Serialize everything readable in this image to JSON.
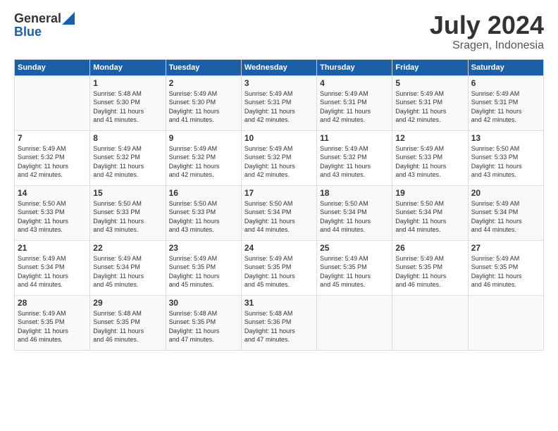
{
  "header": {
    "logo_general": "General",
    "logo_blue": "Blue",
    "month_title": "July 2024",
    "location": "Sragen, Indonesia"
  },
  "days_of_week": [
    "Sunday",
    "Monday",
    "Tuesday",
    "Wednesday",
    "Thursday",
    "Friday",
    "Saturday"
  ],
  "weeks": [
    {
      "days": [
        {
          "number": "",
          "sunrise": "",
          "sunset": "",
          "daylight": ""
        },
        {
          "number": "1",
          "sunrise": "Sunrise: 5:48 AM",
          "sunset": "Sunset: 5:30 PM",
          "daylight": "Daylight: 11 hours and 41 minutes."
        },
        {
          "number": "2",
          "sunrise": "Sunrise: 5:49 AM",
          "sunset": "Sunset: 5:30 PM",
          "daylight": "Daylight: 11 hours and 41 minutes."
        },
        {
          "number": "3",
          "sunrise": "Sunrise: 5:49 AM",
          "sunset": "Sunset: 5:31 PM",
          "daylight": "Daylight: 11 hours and 42 minutes."
        },
        {
          "number": "4",
          "sunrise": "Sunrise: 5:49 AM",
          "sunset": "Sunset: 5:31 PM",
          "daylight": "Daylight: 11 hours and 42 minutes."
        },
        {
          "number": "5",
          "sunrise": "Sunrise: 5:49 AM",
          "sunset": "Sunset: 5:31 PM",
          "daylight": "Daylight: 11 hours and 42 minutes."
        },
        {
          "number": "6",
          "sunrise": "Sunrise: 5:49 AM",
          "sunset": "Sunset: 5:31 PM",
          "daylight": "Daylight: 11 hours and 42 minutes."
        }
      ]
    },
    {
      "days": [
        {
          "number": "7",
          "sunrise": "Sunrise: 5:49 AM",
          "sunset": "Sunset: 5:32 PM",
          "daylight": "Daylight: 11 hours and 42 minutes."
        },
        {
          "number": "8",
          "sunrise": "Sunrise: 5:49 AM",
          "sunset": "Sunset: 5:32 PM",
          "daylight": "Daylight: 11 hours and 42 minutes."
        },
        {
          "number": "9",
          "sunrise": "Sunrise: 5:49 AM",
          "sunset": "Sunset: 5:32 PM",
          "daylight": "Daylight: 11 hours and 42 minutes."
        },
        {
          "number": "10",
          "sunrise": "Sunrise: 5:49 AM",
          "sunset": "Sunset: 5:32 PM",
          "daylight": "Daylight: 11 hours and 42 minutes."
        },
        {
          "number": "11",
          "sunrise": "Sunrise: 5:49 AM",
          "sunset": "Sunset: 5:32 PM",
          "daylight": "Daylight: 11 hours and 43 minutes."
        },
        {
          "number": "12",
          "sunrise": "Sunrise: 5:49 AM",
          "sunset": "Sunset: 5:33 PM",
          "daylight": "Daylight: 11 hours and 43 minutes."
        },
        {
          "number": "13",
          "sunrise": "Sunrise: 5:50 AM",
          "sunset": "Sunset: 5:33 PM",
          "daylight": "Daylight: 11 hours and 43 minutes."
        }
      ]
    },
    {
      "days": [
        {
          "number": "14",
          "sunrise": "Sunrise: 5:50 AM",
          "sunset": "Sunset: 5:33 PM",
          "daylight": "Daylight: 11 hours and 43 minutes."
        },
        {
          "number": "15",
          "sunrise": "Sunrise: 5:50 AM",
          "sunset": "Sunset: 5:33 PM",
          "daylight": "Daylight: 11 hours and 43 minutes."
        },
        {
          "number": "16",
          "sunrise": "Sunrise: 5:50 AM",
          "sunset": "Sunset: 5:33 PM",
          "daylight": "Daylight: 11 hours and 43 minutes."
        },
        {
          "number": "17",
          "sunrise": "Sunrise: 5:50 AM",
          "sunset": "Sunset: 5:34 PM",
          "daylight": "Daylight: 11 hours and 44 minutes."
        },
        {
          "number": "18",
          "sunrise": "Sunrise: 5:50 AM",
          "sunset": "Sunset: 5:34 PM",
          "daylight": "Daylight: 11 hours and 44 minutes."
        },
        {
          "number": "19",
          "sunrise": "Sunrise: 5:50 AM",
          "sunset": "Sunset: 5:34 PM",
          "daylight": "Daylight: 11 hours and 44 minutes."
        },
        {
          "number": "20",
          "sunrise": "Sunrise: 5:49 AM",
          "sunset": "Sunset: 5:34 PM",
          "daylight": "Daylight: 11 hours and 44 minutes."
        }
      ]
    },
    {
      "days": [
        {
          "number": "21",
          "sunrise": "Sunrise: 5:49 AM",
          "sunset": "Sunset: 5:34 PM",
          "daylight": "Daylight: 11 hours and 44 minutes."
        },
        {
          "number": "22",
          "sunrise": "Sunrise: 5:49 AM",
          "sunset": "Sunset: 5:34 PM",
          "daylight": "Daylight: 11 hours and 45 minutes."
        },
        {
          "number": "23",
          "sunrise": "Sunrise: 5:49 AM",
          "sunset": "Sunset: 5:35 PM",
          "daylight": "Daylight: 11 hours and 45 minutes."
        },
        {
          "number": "24",
          "sunrise": "Sunrise: 5:49 AM",
          "sunset": "Sunset: 5:35 PM",
          "daylight": "Daylight: 11 hours and 45 minutes."
        },
        {
          "number": "25",
          "sunrise": "Sunrise: 5:49 AM",
          "sunset": "Sunset: 5:35 PM",
          "daylight": "Daylight: 11 hours and 45 minutes."
        },
        {
          "number": "26",
          "sunrise": "Sunrise: 5:49 AM",
          "sunset": "Sunset: 5:35 PM",
          "daylight": "Daylight: 11 hours and 46 minutes."
        },
        {
          "number": "27",
          "sunrise": "Sunrise: 5:49 AM",
          "sunset": "Sunset: 5:35 PM",
          "daylight": "Daylight: 11 hours and 46 minutes."
        }
      ]
    },
    {
      "days": [
        {
          "number": "28",
          "sunrise": "Sunrise: 5:49 AM",
          "sunset": "Sunset: 5:35 PM",
          "daylight": "Daylight: 11 hours and 46 minutes."
        },
        {
          "number": "29",
          "sunrise": "Sunrise: 5:48 AM",
          "sunset": "Sunset: 5:35 PM",
          "daylight": "Daylight: 11 hours and 46 minutes."
        },
        {
          "number": "30",
          "sunrise": "Sunrise: 5:48 AM",
          "sunset": "Sunset: 5:35 PM",
          "daylight": "Daylight: 11 hours and 47 minutes."
        },
        {
          "number": "31",
          "sunrise": "Sunrise: 5:48 AM",
          "sunset": "Sunset: 5:36 PM",
          "daylight": "Daylight: 11 hours and 47 minutes."
        },
        {
          "number": "",
          "sunrise": "",
          "sunset": "",
          "daylight": ""
        },
        {
          "number": "",
          "sunrise": "",
          "sunset": "",
          "daylight": ""
        },
        {
          "number": "",
          "sunrise": "",
          "sunset": "",
          "daylight": ""
        }
      ]
    }
  ]
}
